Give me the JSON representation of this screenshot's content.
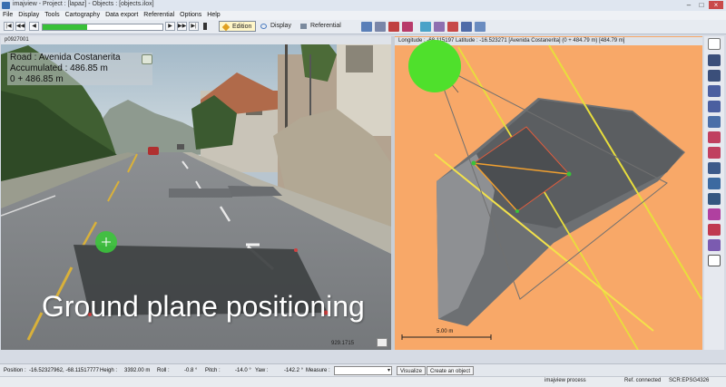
{
  "window": {
    "title": "imajview - Project : [lapaz] - Objects : [objects.ilox]"
  },
  "menu": [
    "File",
    "Display",
    "Tools",
    "Cartography",
    "Data export",
    "Referential",
    "Options",
    "Help"
  ],
  "toolbar": {
    "edition_label": "Edition",
    "display_label": "Display",
    "referential_label": "Referential"
  },
  "left_view": {
    "image_name": "p0927001",
    "road": "Road : Avenida Costanerita",
    "accumulated": "Accumulated : 486.85 m",
    "pk": "0 + 486.85 m",
    "bottom_readout": "929.1715"
  },
  "right_view": {
    "header": "Longitude : -68.115197  Latitude : -16.523271  [Avenida Costanerita]  (0 + 484.79 m)  [484.79 m]",
    "scale_label": "5.00 m"
  },
  "overlay": {
    "caption": "Ground plane positioning"
  },
  "status": {
    "position_label": "Position :",
    "position_value": "-16.52327962,  -68.11517777",
    "height_label": "Heigh :",
    "height_value": "3392.00 m",
    "roll_label": "Roll :",
    "roll_value": "-0.8 °",
    "pitch_label": "Pitch :",
    "pitch_value": "-14.0 °",
    "yaw_label": "Yaw :",
    "yaw_value": "-142.2 °",
    "measure_label": "Measure :",
    "visualize_label": "Visualize",
    "create_label": "Create an object"
  },
  "bottom": {
    "process": "imajview process",
    "connection": "Ref. connected",
    "scr": "SCR:EPSG4326"
  },
  "colors": {
    "map_background": "#f8a868",
    "progress_green": "#38c038",
    "accent_yellow": "#f3e24a"
  }
}
